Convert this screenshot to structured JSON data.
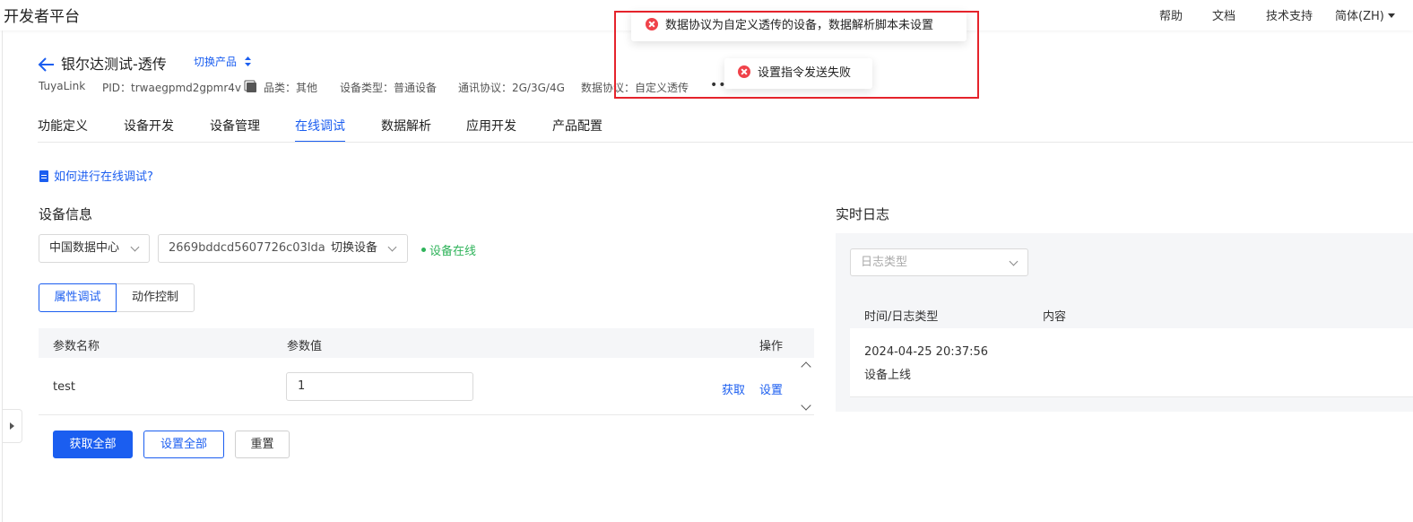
{
  "topbar": {
    "brand": "开发者平台",
    "nav": [
      "帮助",
      "文档",
      "技术支持"
    ],
    "language": "简体(ZH)"
  },
  "product": {
    "name": "银尔达测试-透传",
    "switch_label": "切换产品",
    "meta": {
      "platform": "TuyaLink",
      "pid_label": "PID：",
      "pid": "trwaegpmd2gpmr4v",
      "category": "品类：其他",
      "device_type": "设备类型：普通设备",
      "comm_protocol": "通讯协议：2G/3G/4G",
      "data_protocol": "数据协议：自定义透传"
    }
  },
  "tabs": [
    {
      "label": "功能定义"
    },
    {
      "label": "设备开发"
    },
    {
      "label": "设备管理"
    },
    {
      "label": "在线调试",
      "active": true
    },
    {
      "label": "数据解析"
    },
    {
      "label": "应用开发"
    },
    {
      "label": "产品配置"
    }
  ],
  "help_link": "如何进行在线调试?",
  "device_info": {
    "title": "设备信息",
    "datacenter": "中国数据中心",
    "device_id": "2669bddcd5607726c03lda",
    "switch_device": "切换设备",
    "status": "设备在线",
    "status_color": "#2fb35a"
  },
  "segmented": [
    "属性调试",
    "动作控制"
  ],
  "table": {
    "headers": [
      "参数名称",
      "参数值",
      "操作"
    ],
    "rows": [
      {
        "name": "test",
        "value": "1",
        "actions": [
          "获取",
          "设置"
        ]
      }
    ]
  },
  "buttons": {
    "get_all": "获取全部",
    "set_all": "设置全部",
    "reset": "重置"
  },
  "log": {
    "title": "实时日志",
    "type_placeholder": "日志类型",
    "headers": [
      "时间/日志类型",
      "内容"
    ],
    "entries": [
      {
        "time": "2024-04-25 20:37:56",
        "type": "设备上线"
      }
    ]
  },
  "toasts": [
    "数据协议为自定义透传的设备，数据解析脚本未设置",
    "设置指令发送失败"
  ],
  "colors": {
    "primary": "#1b5ef0",
    "error": "#f0424a",
    "highlight": "#e5232b"
  }
}
